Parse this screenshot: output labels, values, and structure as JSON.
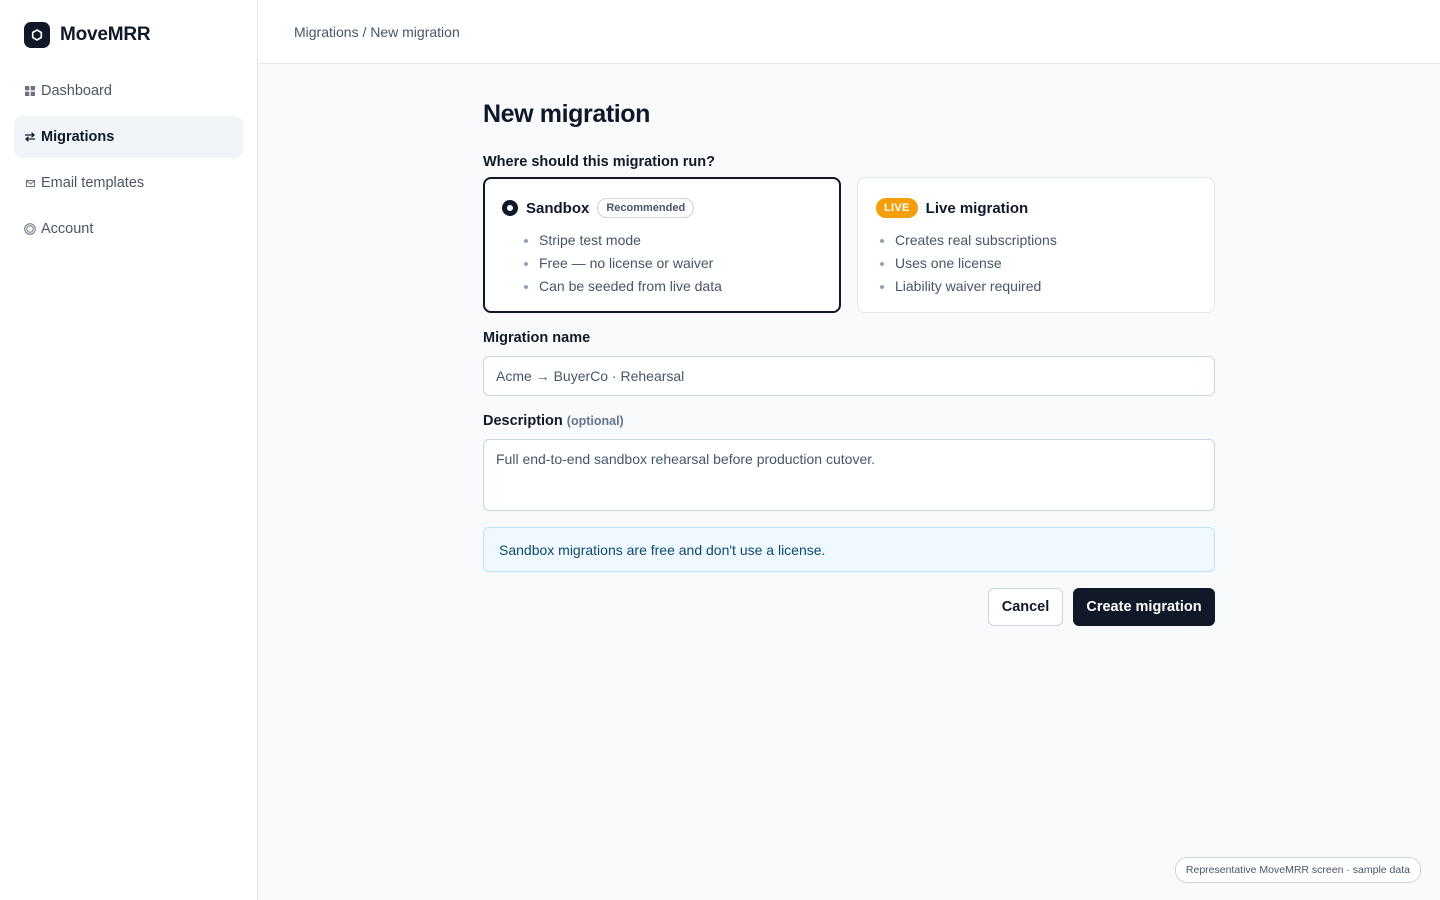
{
  "app": {
    "name": "MoveMRR"
  },
  "sidebar": {
    "items": [
      {
        "label": "Dashboard",
        "icon": "grid-icon",
        "active": false
      },
      {
        "label": "Migrations",
        "icon": "arrows-icon",
        "active": true
      },
      {
        "label": "Email templates",
        "icon": "envelope-icon",
        "active": false
      },
      {
        "label": "Account",
        "icon": "user-circle-icon",
        "active": false
      }
    ]
  },
  "topbar": {
    "breadcrumb": "Migrations / New migration"
  },
  "main": {
    "title": "New migration",
    "environment_label": "Where should this migration run?",
    "options": [
      {
        "title": "Sandbox",
        "badge": "Recommended",
        "selected": true,
        "bullets": [
          "Stripe test mode",
          "Free — no license or waiver",
          "Can be seeded from live data"
        ]
      },
      {
        "title": "Live migration",
        "badge": "LIVE",
        "selected": false,
        "bullets": [
          "Creates real subscriptions",
          "Uses one license",
          "Liability waiver required"
        ]
      }
    ],
    "name_field": {
      "label": "Migration name",
      "value": "Acme → BuyerCo · Rehearsal"
    },
    "description_field": {
      "label": "Description",
      "optional": "(optional)",
      "value": "Full end-to-end sandbox rehearsal before production cutover."
    },
    "info": "Sandbox migrations are free and don't use a license.",
    "actions": {
      "cancel": "Cancel",
      "create": "Create migration"
    }
  },
  "footer": {
    "note": "Representative MoveMRR screen · sample data"
  },
  "colors": {
    "primary": "#111827",
    "live": "#f59e0b",
    "info_bg": "#f0f9ff"
  }
}
